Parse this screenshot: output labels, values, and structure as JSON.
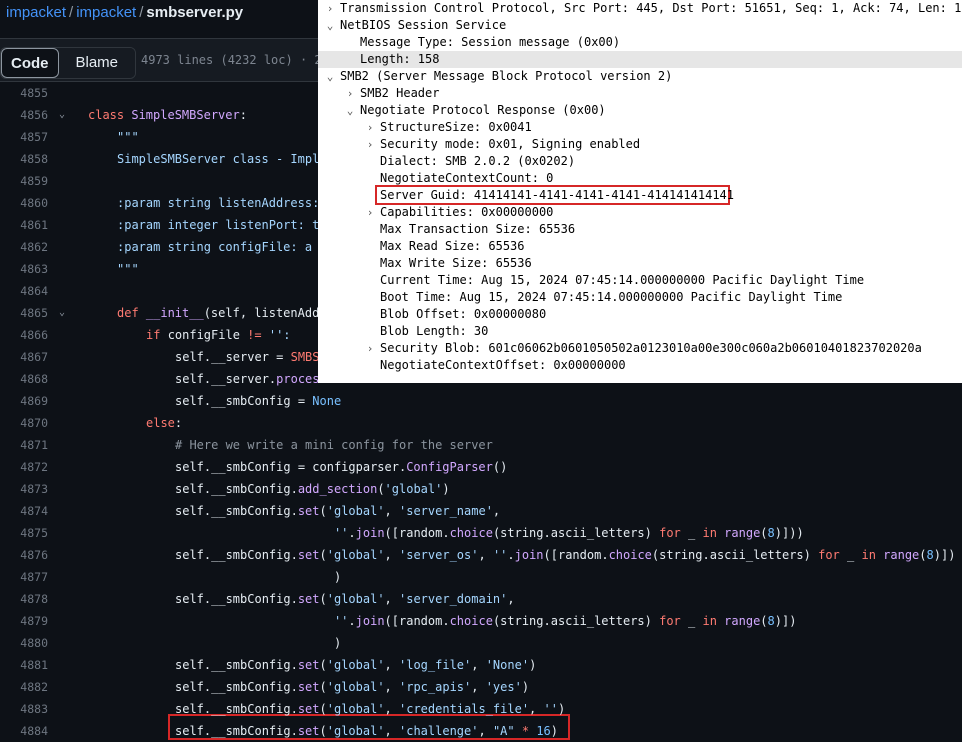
{
  "breadcrumb": {
    "org": "impacket",
    "repo": "impacket",
    "sep": "/",
    "file": "smbserver.py"
  },
  "tabs": {
    "code": "Code",
    "blame": "Blame"
  },
  "file_info": "4973 lines (4232 loc) · 2",
  "code_lines": [
    {
      "n": "4855",
      "fold": "",
      "ind": 0,
      "t": []
    },
    {
      "n": "4856",
      "fold": "⌄",
      "ind": 0,
      "t": [
        [
          "kw",
          "class "
        ],
        [
          "fn",
          "SimpleSMBServer"
        ],
        [
          "df",
          ":"
        ]
      ]
    },
    {
      "n": "4857",
      "fold": "",
      "ind": 1,
      "t": [
        [
          "str",
          "\"\"\""
        ]
      ]
    },
    {
      "n": "4858",
      "fold": "",
      "ind": 1,
      "t": [
        [
          "str",
          "SimpleSMBServer class - Impl"
        ]
      ]
    },
    {
      "n": "4859",
      "fold": "",
      "ind": 0,
      "t": []
    },
    {
      "n": "4860",
      "fold": "",
      "ind": 1,
      "t": [
        [
          "str",
          ":param string listenAddress:"
        ]
      ]
    },
    {
      "n": "4861",
      "fold": "",
      "ind": 1,
      "t": [
        [
          "str",
          ":param integer listenPort: t"
        ]
      ]
    },
    {
      "n": "4862",
      "fold": "",
      "ind": 1,
      "t": [
        [
          "str",
          ":param string configFile: a"
        ]
      ]
    },
    {
      "n": "4863",
      "fold": "",
      "ind": 1,
      "t": [
        [
          "str",
          "\"\"\""
        ]
      ]
    },
    {
      "n": "4864",
      "fold": "",
      "ind": 0,
      "t": []
    },
    {
      "n": "4865",
      "fold": "⌄",
      "ind": 1,
      "t": [
        [
          "kw",
          "def "
        ],
        [
          "fn",
          "__init__"
        ],
        [
          "df",
          "(self, listenAdd"
        ]
      ]
    },
    {
      "n": "4866",
      "fold": "",
      "ind": 2,
      "t": [
        [
          "kw",
          "if "
        ],
        [
          "df",
          "configFile "
        ],
        [
          "kw",
          "!= "
        ],
        [
          "str",
          "'':"
        ]
      ]
    },
    {
      "n": "4867",
      "fold": "",
      "ind": 3,
      "t": [
        [
          "df",
          "self.__server = "
        ],
        [
          "kw",
          "SMBS"
        ]
      ]
    },
    {
      "n": "4868",
      "fold": "",
      "ind": 3,
      "t": [
        [
          "df",
          "self.__server."
        ],
        [
          "fn",
          "proces"
        ]
      ]
    },
    {
      "n": "4869",
      "fold": "",
      "ind": 3,
      "t": [
        [
          "df",
          "self.__smbConfig = "
        ],
        [
          "blt",
          "None"
        ]
      ]
    },
    {
      "n": "4870",
      "fold": "",
      "ind": 2,
      "t": [
        [
          "kw",
          "else"
        ],
        [
          "df",
          ":"
        ]
      ]
    },
    {
      "n": "4871",
      "fold": "",
      "ind": 3,
      "t": [
        [
          "cm",
          "# Here we write a mini config for the server"
        ]
      ]
    },
    {
      "n": "4872",
      "fold": "",
      "ind": 3,
      "t": [
        [
          "df",
          "self.__smbConfig = configparser."
        ],
        [
          "fn",
          "ConfigParser"
        ],
        [
          "df",
          "()"
        ]
      ]
    },
    {
      "n": "4873",
      "fold": "",
      "ind": 3,
      "t": [
        [
          "df",
          "self.__smbConfig."
        ],
        [
          "fn",
          "add_section"
        ],
        [
          "df",
          "("
        ],
        [
          "str",
          "'global'"
        ],
        [
          "df",
          ")"
        ]
      ]
    },
    {
      "n": "4874",
      "fold": "",
      "ind": 3,
      "t": [
        [
          "df",
          "self.__smbConfig."
        ],
        [
          "fn",
          "set"
        ],
        [
          "df",
          "("
        ],
        [
          "str",
          "'global'"
        ],
        [
          "df",
          ", "
        ],
        [
          "str",
          "'server_name'"
        ],
        [
          "df",
          ","
        ]
      ]
    },
    {
      "n": "4875",
      "fold": "",
      "ind": 3,
      "t": [
        [
          "df",
          "                      "
        ],
        [
          "str",
          "''"
        ],
        [
          "df",
          "."
        ],
        [
          "fn",
          "join"
        ],
        [
          "df",
          "([random."
        ],
        [
          "fn",
          "choice"
        ],
        [
          "df",
          "(string.ascii_letters) "
        ],
        [
          "kw",
          "for"
        ],
        [
          "df",
          " _ "
        ],
        [
          "kw",
          "in "
        ],
        [
          "fn",
          "range"
        ],
        [
          "df",
          "("
        ],
        [
          "blt",
          "8"
        ],
        [
          "df",
          ")]))"
        ]
      ]
    },
    {
      "n": "4876",
      "fold": "",
      "ind": 3,
      "t": [
        [
          "df",
          "self.__smbConfig."
        ],
        [
          "fn",
          "set"
        ],
        [
          "df",
          "("
        ],
        [
          "str",
          "'global'"
        ],
        [
          "df",
          ", "
        ],
        [
          "str",
          "'server_os'"
        ],
        [
          "df",
          ", "
        ],
        [
          "str",
          "''"
        ],
        [
          "df",
          "."
        ],
        [
          "fn",
          "join"
        ],
        [
          "df",
          "([random."
        ],
        [
          "fn",
          "choice"
        ],
        [
          "df",
          "(string.ascii_letters) "
        ],
        [
          "kw",
          "for"
        ],
        [
          "df",
          " _ "
        ],
        [
          "kw",
          "in "
        ],
        [
          "fn",
          "range"
        ],
        [
          "df",
          "("
        ],
        [
          "blt",
          "8"
        ],
        [
          "df",
          ")])"
        ]
      ]
    },
    {
      "n": "4877",
      "fold": "",
      "ind": 3,
      "t": [
        [
          "df",
          "                      )"
        ]
      ]
    },
    {
      "n": "4878",
      "fold": "",
      "ind": 3,
      "t": [
        [
          "df",
          "self.__smbConfig."
        ],
        [
          "fn",
          "set"
        ],
        [
          "df",
          "("
        ],
        [
          "str",
          "'global'"
        ],
        [
          "df",
          ", "
        ],
        [
          "str",
          "'server_domain'"
        ],
        [
          "df",
          ","
        ]
      ]
    },
    {
      "n": "4879",
      "fold": "",
      "ind": 3,
      "t": [
        [
          "df",
          "                      "
        ],
        [
          "str",
          "''"
        ],
        [
          "df",
          "."
        ],
        [
          "fn",
          "join"
        ],
        [
          "df",
          "([random."
        ],
        [
          "fn",
          "choice"
        ],
        [
          "df",
          "(string.ascii_letters) "
        ],
        [
          "kw",
          "for"
        ],
        [
          "df",
          " _ "
        ],
        [
          "kw",
          "in "
        ],
        [
          "fn",
          "range"
        ],
        [
          "df",
          "("
        ],
        [
          "blt",
          "8"
        ],
        [
          "df",
          ")])"
        ]
      ]
    },
    {
      "n": "4880",
      "fold": "",
      "ind": 3,
      "t": [
        [
          "df",
          "                      )"
        ]
      ]
    },
    {
      "n": "4881",
      "fold": "",
      "ind": 3,
      "t": [
        [
          "df",
          "self.__smbConfig."
        ],
        [
          "fn",
          "set"
        ],
        [
          "df",
          "("
        ],
        [
          "str",
          "'global'"
        ],
        [
          "df",
          ", "
        ],
        [
          "str",
          "'log_file'"
        ],
        [
          "df",
          ", "
        ],
        [
          "str",
          "'None'"
        ],
        [
          "df",
          ")"
        ]
      ]
    },
    {
      "n": "4882",
      "fold": "",
      "ind": 3,
      "t": [
        [
          "df",
          "self.__smbConfig."
        ],
        [
          "fn",
          "set"
        ],
        [
          "df",
          "("
        ],
        [
          "str",
          "'global'"
        ],
        [
          "df",
          ", "
        ],
        [
          "str",
          "'rpc_apis'"
        ],
        [
          "df",
          ", "
        ],
        [
          "str",
          "'yes'"
        ],
        [
          "df",
          ")"
        ]
      ]
    },
    {
      "n": "4883",
      "fold": "",
      "ind": 3,
      "t": [
        [
          "df",
          "self.__smbConfig."
        ],
        [
          "fn",
          "set"
        ],
        [
          "df",
          "("
        ],
        [
          "str",
          "'global'"
        ],
        [
          "df",
          ", "
        ],
        [
          "str",
          "'credentials_file'"
        ],
        [
          "df",
          ", "
        ],
        [
          "str",
          "''"
        ],
        [
          "df",
          ")"
        ]
      ]
    },
    {
      "n": "4884",
      "fold": "",
      "ind": 3,
      "t": [
        [
          "df",
          "self.__smbConfig."
        ],
        [
          "fn",
          "set"
        ],
        [
          "df",
          "("
        ],
        [
          "str",
          "'global'"
        ],
        [
          "df",
          ", "
        ],
        [
          "str",
          "'challenge'"
        ],
        [
          "df",
          ", "
        ],
        [
          "str",
          "\"A\""
        ],
        [
          "df",
          " "
        ],
        [
          "kw",
          "*"
        ],
        [
          "df",
          " "
        ],
        [
          "blt",
          "16"
        ],
        [
          "df",
          ")"
        ]
      ]
    }
  ],
  "ws_rows": [
    {
      "arrow": "›",
      "level": 0,
      "text": "Transmission Control Protocol, Src Port: 445, Dst Port: 51651, Seq: 1, Ack: 74, Len: 162"
    },
    {
      "arrow": "⌄",
      "level": 0,
      "text": "NetBIOS Session Service"
    },
    {
      "arrow": "",
      "level": 1,
      "text": "Message Type: Session message (0x00)"
    },
    {
      "arrow": "",
      "level": 1,
      "text": "Length: 158",
      "selected": true
    },
    {
      "arrow": "⌄",
      "level": 0,
      "text": "SMB2 (Server Message Block Protocol version 2)"
    },
    {
      "arrow": "›",
      "level": 1,
      "text": "SMB2 Header"
    },
    {
      "arrow": "⌄",
      "level": 1,
      "text": "Negotiate Protocol Response (0x00)"
    },
    {
      "arrow": "›",
      "level": 2,
      "text": "StructureSize: 0x0041"
    },
    {
      "arrow": "›",
      "level": 2,
      "text": "Security mode: 0x01, Signing enabled"
    },
    {
      "arrow": "",
      "level": 2,
      "text": "Dialect: SMB 2.0.2 (0x0202)"
    },
    {
      "arrow": "",
      "level": 2,
      "text": "NegotiateContextCount: 0"
    },
    {
      "arrow": "",
      "level": 2,
      "text": "Server Guid: 41414141-4141-4141-4141-414141414141"
    },
    {
      "arrow": "›",
      "level": 2,
      "text": "Capabilities: 0x00000000"
    },
    {
      "arrow": "",
      "level": 2,
      "text": "Max Transaction Size: 65536"
    },
    {
      "arrow": "",
      "level": 2,
      "text": "Max Read Size: 65536"
    },
    {
      "arrow": "",
      "level": 2,
      "text": "Max Write Size: 65536"
    },
    {
      "arrow": "",
      "level": 2,
      "text": "Current Time: Aug 15, 2024 07:45:14.000000000 Pacific Daylight Time"
    },
    {
      "arrow": "",
      "level": 2,
      "text": "Boot Time: Aug 15, 2024 07:45:14.000000000 Pacific Daylight Time"
    },
    {
      "arrow": "",
      "level": 2,
      "text": "Blob Offset: 0x00000080"
    },
    {
      "arrow": "",
      "level": 2,
      "text": "Blob Length: 30"
    },
    {
      "arrow": "›",
      "level": 2,
      "text": "Security Blob: 601c06062b0601050502a0123010a00e300c060a2b06010401823702020a"
    },
    {
      "arrow": "",
      "level": 2,
      "text": "NegotiateContextOffset: 0x00000000"
    }
  ]
}
